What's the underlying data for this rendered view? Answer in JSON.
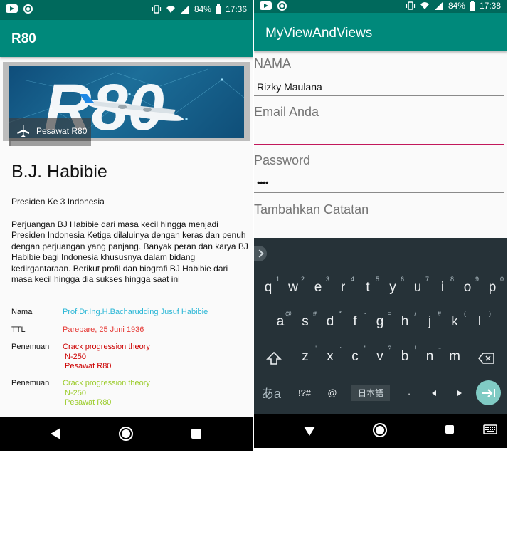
{
  "status_left": {
    "battery": "84%",
    "time": "17:36"
  },
  "status_right": {
    "battery": "84%",
    "time": "17:38"
  },
  "left_app": {
    "title": "R80",
    "banner_caption": "Pesawat R80",
    "banner_logo_text": "R80",
    "name": "B.J. Habibie",
    "subtitle": "Presiden Ke 3 Indonesia",
    "description": "Perjuangan BJ Habibie dari masa kecil hingga menjadi Presiden Indonesia Ketiga dilaluinya dengan keras dan penuh dengan perjuangan yang panjang. Banyak peran dan karya BJ Habibie bagi Indonesia khususnya dalam bidang kedirgantaraan. Berikut profil dan biografi BJ Habibie dari masa kecil hingga dia sukses hingga saat ini",
    "rows": {
      "nama": {
        "label": "Nama",
        "value": "Prof.Dr.Ing.H.Bacharudding Jusuf Habibie",
        "color": "#29b6d6"
      },
      "ttl": {
        "label": "TTL",
        "value": "Parepare, 25 Juni 1936",
        "color": "#e53935"
      },
      "penemuan1": {
        "label": "Penemuan",
        "line1": "Crack progression theory",
        "line2": "N-250",
        "line3": "Pesawat R80",
        "color": "#cc0000"
      },
      "penemuan2": {
        "label": "Penemuan",
        "line1": "Crack progression theory",
        "line2": "N-250",
        "line3": "Pesawat R80",
        "color": "#9ccc2c"
      }
    }
  },
  "right_app": {
    "title": "MyViewAndViews",
    "nama_label": "NAMA",
    "nama_value": "Rizky Maulana",
    "email_label": "Email Anda",
    "password_label": "Password",
    "password_value": "••••",
    "notes_label": "Tambahkan Catatan"
  },
  "keyboard": {
    "row1": [
      "q",
      "w",
      "e",
      "r",
      "t",
      "y",
      "u",
      "i",
      "o",
      "p"
    ],
    "row1_hints": [
      "1",
      "2",
      "3",
      "4",
      "5",
      "6",
      "7",
      "8",
      "9",
      "0"
    ],
    "row2": [
      "a",
      "s",
      "d",
      "f",
      "g",
      "h",
      "j",
      "k",
      "l"
    ],
    "row2_hints": [
      "@",
      "#",
      "*",
      "-",
      "=",
      "/",
      "#",
      "(",
      ")"
    ],
    "row3": [
      "z",
      "x",
      "c",
      "v",
      "b",
      "n",
      "m"
    ],
    "row3_hints": [
      "'",
      ":",
      "\"",
      "?",
      "!",
      "~",
      "…"
    ],
    "mode_key": "あa",
    "symbols_key": "!?#",
    "at_key": "@",
    "language_key": "日本語",
    "period_key": "."
  },
  "colors": {
    "statusbar": "#00695c",
    "appbar": "#00897b",
    "focus_underline": "#c2185b",
    "enter_key": "#80cbc4"
  }
}
